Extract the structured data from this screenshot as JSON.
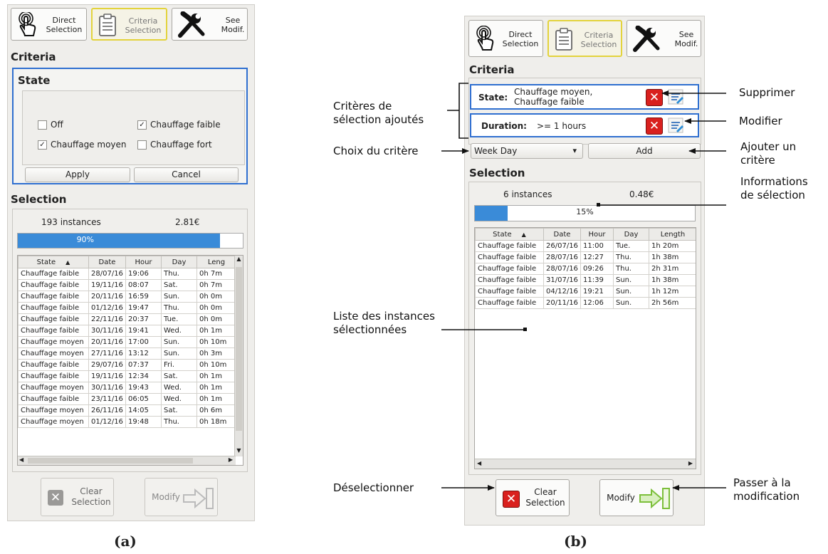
{
  "panel_a": {
    "toolbar": {
      "direct_line1": "Direct",
      "direct_line2": "Selection",
      "criteria_line1": "Criteria",
      "criteria_line2": "Selection",
      "see_line1": "See",
      "see_line2": "Modif."
    },
    "criteria_title": "Criteria",
    "state_title": "State",
    "checks": [
      {
        "label": "Off",
        "checked": false
      },
      {
        "label": "Chauffage faible",
        "checked": true
      },
      {
        "label": "Chauffage moyen",
        "checked": true
      },
      {
        "label": "Chauffage fort",
        "checked": false
      }
    ],
    "checkmark": "✓",
    "apply_label": "Apply",
    "cancel_label": "Cancel",
    "selection_title": "Selection",
    "instances": "193 instances",
    "cost": "2.81€",
    "progress_text": "90%",
    "progress_fraction": 0.9,
    "columns": [
      "State",
      "Date",
      "Hour",
      "Day",
      "Leng"
    ],
    "sort_glyph": "▲",
    "rows": [
      [
        "Chauffage faible",
        "28/07/16",
        "19:06",
        "Thu.",
        "0h 7m"
      ],
      [
        "Chauffage faible",
        "19/11/16",
        "08:07",
        "Sat.",
        "0h 7m"
      ],
      [
        "Chauffage faible",
        "20/11/16",
        "16:59",
        "Sun.",
        "0h 0m"
      ],
      [
        "Chauffage faible",
        "01/12/16",
        "19:47",
        "Thu.",
        "0h 0m"
      ],
      [
        "Chauffage faible",
        "22/11/16",
        "20:37",
        "Tue.",
        "0h 0m"
      ],
      [
        "Chauffage faible",
        "30/11/16",
        "19:41",
        "Wed.",
        "0h 1m"
      ],
      [
        "Chauffage moyen",
        "20/11/16",
        "17:00",
        "Sun.",
        "0h 10m"
      ],
      [
        "Chauffage moyen",
        "27/11/16",
        "13:12",
        "Sun.",
        "0h 3m"
      ],
      [
        "Chauffage faible",
        "29/07/16",
        "07:37",
        "Fri.",
        "0h 10m"
      ],
      [
        "Chauffage faible",
        "19/11/16",
        "12:34",
        "Sat.",
        "0h 1m"
      ],
      [
        "Chauffage moyen",
        "30/11/16",
        "19:43",
        "Wed.",
        "0h 1m"
      ],
      [
        "Chauffage faible",
        "23/11/16",
        "06:05",
        "Wed.",
        "0h 1m"
      ],
      [
        "Chauffage moyen",
        "26/11/16",
        "14:05",
        "Sat.",
        "0h 6m"
      ],
      [
        "Chauffage moyen",
        "01/12/16",
        "19:48",
        "Thu.",
        "0h 18m"
      ]
    ],
    "clear_line1": "Clear",
    "clear_line2": "Selection",
    "modify_label": "Modify"
  },
  "panel_b": {
    "toolbar": {
      "direct_line1": "Direct",
      "direct_line2": "Selection",
      "criteria_line1": "Criteria",
      "criteria_line2": "Selection",
      "see_line1": "See",
      "see_line2": "Modif."
    },
    "criteria_title": "Criteria",
    "state_key": "State:",
    "state_value_line1": "Chauffage moyen,",
    "state_value_line2": "Chauffage faible",
    "duration_key": "Duration:",
    "duration_value": ">= 1 hours",
    "combo_value": "Week Day",
    "combo_arrow": "▾",
    "add_label": "Add",
    "remove_glyph": "✕",
    "selection_title": "Selection",
    "instances": "6 instances",
    "cost": "0.48€",
    "progress_text": "15%",
    "progress_fraction": 0.15,
    "columns": [
      "State",
      "Date",
      "Hour",
      "Day",
      "Length"
    ],
    "sort_glyph": "▲",
    "rows": [
      [
        "Chauffage faible",
        "26/07/16",
        "11:00",
        "Tue.",
        "1h 20m"
      ],
      [
        "Chauffage faible",
        "28/07/16",
        "12:27",
        "Thu.",
        "1h 38m"
      ],
      [
        "Chauffage faible",
        "28/07/16",
        "09:26",
        "Thu.",
        "2h 31m"
      ],
      [
        "Chauffage faible",
        "31/07/16",
        "11:39",
        "Sun.",
        "1h 38m"
      ],
      [
        "Chauffage faible",
        "04/12/16",
        "19:21",
        "Sun.",
        "1h 12m"
      ],
      [
        "Chauffage faible",
        "20/11/16",
        "12:06",
        "Sun.",
        "2h 56m"
      ]
    ],
    "clear_line1": "Clear",
    "clear_line2": "Selection",
    "modify_label": "Modify"
  },
  "annotations": {
    "criteres_line1": "Critères de",
    "criteres_line2": "sélection ajoutés",
    "choix": "Choix du critère",
    "liste_line1": "Liste des instances",
    "liste_line2": "sélectionnées",
    "deselect": "Déselectionner",
    "supprimer": "Supprimer",
    "modifier": "Modifier",
    "ajouter_line1": "Ajouter un",
    "ajouter_line2": "critère",
    "info_line1": "Informations",
    "info_line2": "de sélection",
    "passer_line1": "Passer à la",
    "passer_line2": "modification"
  },
  "captions": {
    "a": "(a)",
    "b": "(b)"
  },
  "colors": {
    "accent_blue": "#2f6fd0",
    "progress_blue": "#3a8bd8",
    "remove_red": "#d9201e",
    "active_yellow": "#e3d33c"
  }
}
